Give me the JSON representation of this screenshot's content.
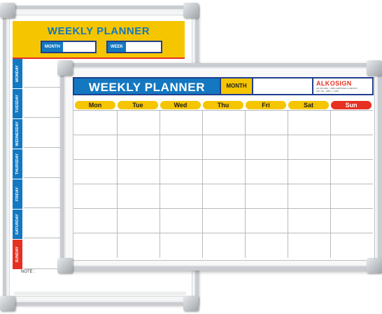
{
  "back_board": {
    "title": "WEEKLY PLANNER",
    "month_label": "MONTH",
    "week_label": "WEEK",
    "days": [
      "MONDAY",
      "TUESDAY",
      "WEDNESDAY",
      "THURSDAY",
      "FRIDAY",
      "SATURDAY",
      "SUNDAY"
    ],
    "note_label": "NOTE :"
  },
  "front_board": {
    "title": "WEEKLY PLANNER",
    "month_label": "MONTH",
    "brand": "ALKOSIGN",
    "brand_sub_1": "AN ISO 9001 : 2008 CERTIFIED COMPANY",
    "brand_sub_2": "ART NO : WBP / L 4030",
    "days": [
      "Mon",
      "Tue",
      "Wed",
      "Thu",
      "Fri",
      "Sat",
      "Sun"
    ]
  },
  "colors": {
    "blue": "#1478c0",
    "yellow": "#f5c500",
    "red": "#e63022",
    "frame": "#c9ccd0"
  }
}
